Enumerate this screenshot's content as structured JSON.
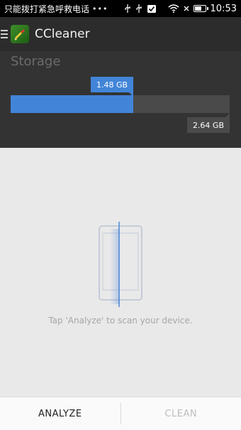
{
  "status_bar": {
    "carrier_text": "只能拨打紧急呼救电话",
    "dots": "•••",
    "time": "10:53",
    "icons": [
      "usb-icon",
      "usb-icon",
      "checkbox-notification-icon",
      "wifi-icon",
      "no-signal-icon",
      "battery-icon"
    ]
  },
  "app_bar": {
    "title": "CCleaner"
  },
  "storage": {
    "title": "Storage",
    "used_label": "1.48 GB",
    "total_label": "2.64 GB",
    "used_gb": 1.48,
    "total_gb": 2.64,
    "colors": {
      "used": "#4285d8",
      "free": "#4a4a4a"
    }
  },
  "main": {
    "hint": "Tap 'Analyze' to scan your device."
  },
  "actions": {
    "analyze_label": "ANALYZE",
    "clean_label": "CLEAN"
  }
}
